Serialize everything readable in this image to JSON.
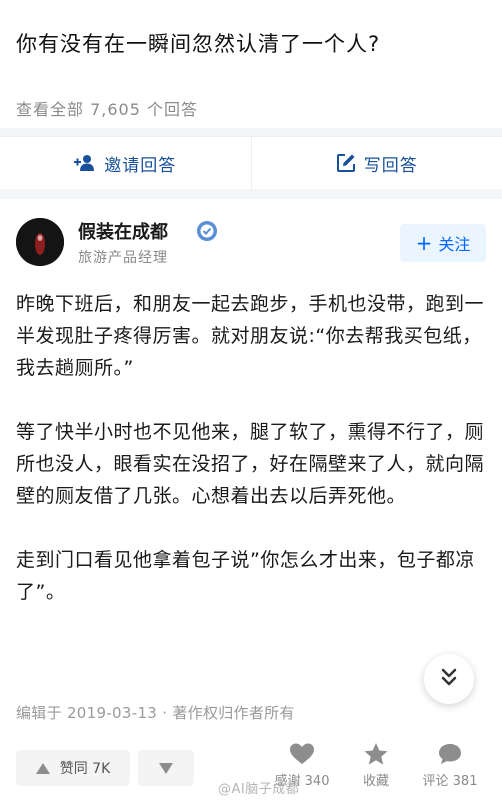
{
  "question": {
    "title": "你有没有在一瞬间忽然认清了一个人?"
  },
  "answers_link": {
    "label": "查看全部 7,605 个回答"
  },
  "actions": {
    "invite_label": "邀请回答",
    "write_label": "写回答"
  },
  "author": {
    "name": "假装在成都",
    "bio": "旅游产品经理",
    "follow_label": "关注"
  },
  "content": {
    "paragraphs": [
      "昨晚下班后，和朋友一起去跑步，手机也没带，跑到一半发现肚子疼得厉害。就对朋友说:“你去帮我买包纸，我去趟厕所。”",
      "等了快半小时也不见他来，腿了软了，熏得不行了，厕所也没人，眼看实在没招了，好在隔壁来了人，就向隔壁的厕友借了几张。心想着出去以后弄死他。",
      "走到门口看见他拿着包子说”你怎么才出来，包子都凉了”。"
    ]
  },
  "meta": {
    "text": "编辑于 2019-03-13 · 著作权归作者所有"
  },
  "bottom": {
    "upvote_label": "赞同 7K",
    "thanks_label": "感谢 340",
    "collect_label": "收藏",
    "comment_label": "评论 381"
  },
  "watermark": {
    "text": "@AI脑子成都"
  },
  "colors": {
    "link_blue": "#175199",
    "follow_blue": "#0066ff",
    "follow_bg": "#ebf5ff",
    "gray": "#8a8a8a"
  },
  "icons": [
    "invite-person-icon",
    "pencil-edit-icon",
    "certified-badge-icon",
    "chevron-double-down-icon",
    "upvote-triangle-icon",
    "downvote-triangle-icon",
    "heart-icon",
    "star-icon",
    "comment-bubble-icon"
  ]
}
